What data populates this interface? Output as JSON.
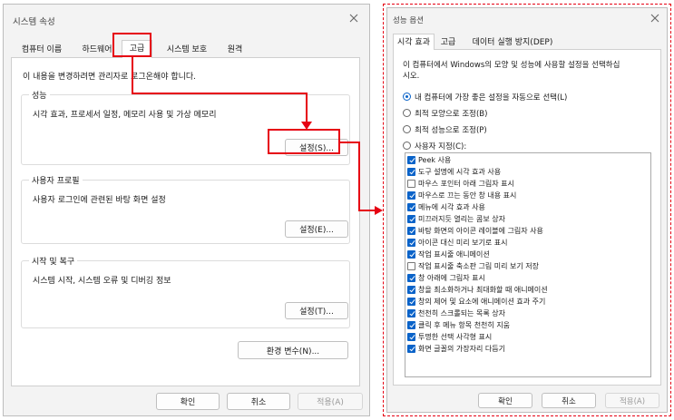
{
  "left_dialog": {
    "title": "시스템 속성",
    "tabs": [
      "컴퓨터 이름",
      "하드웨어",
      "고급",
      "시스템 보호",
      "원격"
    ],
    "notice": "이 내용을 변경하려면 관리자로 로그온해야 합니다.",
    "groups": [
      {
        "title": "성능",
        "desc": "시각 효과, 프로세서 일정, 메모리 사용 및 가상 메모리",
        "button": "설정(S)..."
      },
      {
        "title": "사용자 프로필",
        "desc": "사용자 로그인에 관련된 바탕 화면 설정",
        "button": "설정(E)..."
      },
      {
        "title": "시작 및 복구",
        "desc": "시스템 시작, 시스템 오류 및 디버깅 정보",
        "button": "설정(T)..."
      }
    ],
    "env_button": "환경 변수(N)...",
    "footer": {
      "ok": "확인",
      "cancel": "취소",
      "apply": "적용(A)"
    }
  },
  "right_dialog": {
    "title": "성능 옵션",
    "tabs": [
      "시각 효과",
      "고급",
      "데이터 실행 방지(DEP)"
    ],
    "desc_lines": [
      "이 컴퓨터에서 Windows의 모양 및 성능에 사용할 설정을 선택하십",
      "시오."
    ],
    "radios": [
      {
        "label": "내 컴퓨터에 가장 좋은 설정을 자동으로 선택(L)",
        "selected": true
      },
      {
        "label": "최적 모양으로 조정(B)",
        "selected": false
      },
      {
        "label": "최적 성능으로 조정(P)",
        "selected": false
      },
      {
        "label": "사용자 지정(C):",
        "selected": false
      }
    ],
    "options": [
      {
        "label": "Peek 사용",
        "checked": true
      },
      {
        "label": "도구 설명에 시각 효과 사용",
        "checked": true
      },
      {
        "label": "마우스 포인터 아래 그림자 표시",
        "checked": false
      },
      {
        "label": "마우스로 끄는 동안 창 내용 표시",
        "checked": true
      },
      {
        "label": "메뉴에 시각 효과 사용",
        "checked": true
      },
      {
        "label": "미끄러지듯 열리는 콤보 상자",
        "checked": true
      },
      {
        "label": "바탕 화면의 아이콘 레이블에 그림자 사용",
        "checked": true
      },
      {
        "label": "아이콘 대신 미리 보기로 표시",
        "checked": true
      },
      {
        "label": "작업 표시줄 애니메이션",
        "checked": true
      },
      {
        "label": "작업 표시줄 축소판 그림 미리 보기 저장",
        "checked": false
      },
      {
        "label": "창 아래에 그림자 표시",
        "checked": true
      },
      {
        "label": "창을 최소화하거나 최대화할 때 애니메이션",
        "checked": true
      },
      {
        "label": "창의 제어 및 요소에 애니메이션 효과 주기",
        "checked": true
      },
      {
        "label": "천천히 스크롤되는 목록 상자",
        "checked": true
      },
      {
        "label": "클릭 후 메뉴 항목 천천히 지움",
        "checked": true
      },
      {
        "label": "투명한 선택 사각형 표시",
        "checked": true
      },
      {
        "label": "화면 글꼴의 가장자리 다듬기",
        "checked": true
      }
    ],
    "footer": {
      "ok": "확인",
      "cancel": "취소",
      "apply": "적용(A)"
    }
  },
  "colors": {
    "highlight": "#e60012",
    "accent": "#0a63c9"
  }
}
